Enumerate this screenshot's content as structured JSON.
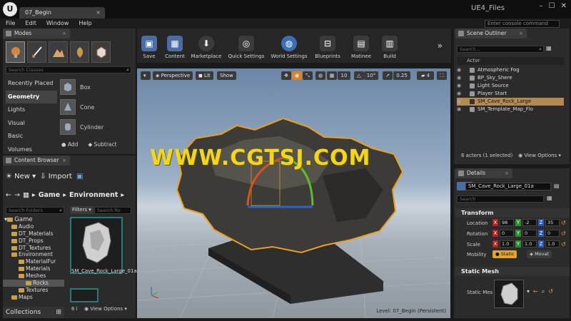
{
  "window": {
    "logo": "U",
    "tab_label": "07_Begin",
    "project_name": "UE4_Files",
    "tab_close": "×",
    "minimize": "–",
    "maximize": "☐",
    "close": "✕"
  },
  "menu": {
    "items": [
      "File",
      "Edit",
      "Window",
      "Help"
    ],
    "console_placeholder": "Enter console command"
  },
  "modes": {
    "tab_label": "Modes",
    "search_placeholder": "Search Classes",
    "categories": [
      "Recently Placed",
      "Geometry",
      "Lights",
      "Visual",
      "Basic",
      "Volumes"
    ],
    "selected_category": "Geometry",
    "shapes": [
      "Box",
      "Cone",
      "Cylinder"
    ],
    "add_label": "Add",
    "subtract_label": "Subtract"
  },
  "content_browser": {
    "tab_label": "Content Browser",
    "new_label": "New",
    "import_label": "Import",
    "breadcrumb": [
      "Game",
      "Environment"
    ],
    "search_folders_placeholder": "Search Folders",
    "filters_label": "Filters",
    "search_assets_placeholder": "Search Ro",
    "tree": [
      "Game",
      "Audio",
      "DT_Materials",
      "DT_Props",
      "DT_Textures",
      "Environment",
      "MaterialFur",
      "Materials",
      "Meshes",
      "Rocks",
      "Textures",
      "Maps"
    ],
    "selected_folder": "Rocks",
    "asset_name": "SM_Cave_Rock_Large_01a",
    "item_count": "6 i",
    "view_options": "View Options",
    "collections_label": "Collections"
  },
  "toolbar": {
    "buttons": [
      {
        "label": "Save",
        "icon": "save-icon",
        "color": "#4a6ea3"
      },
      {
        "label": "Content",
        "icon": "content-icon",
        "color": "#4a6ea3"
      },
      {
        "label": "Marketplace",
        "icon": "marketplace-icon",
        "color": "#3b3b3b"
      },
      {
        "label": "Quick Settings",
        "icon": "settings-icon",
        "color": "#3b3b3b"
      },
      {
        "label": "World Settings",
        "icon": "world-icon",
        "color": "#3c6fb1"
      },
      {
        "label": "Blueprints",
        "icon": "blueprint-icon",
        "color": "#3b3b3b"
      },
      {
        "label": "Matinee",
        "icon": "matinee-icon",
        "color": "#3b3b3b"
      },
      {
        "label": "Build",
        "icon": "build-icon",
        "color": "#3b3b3b"
      }
    ],
    "more": "»"
  },
  "viewport": {
    "perspective_label": "Perspective",
    "lit_label": "Lit",
    "show_label": "Show",
    "grid_snap": "10",
    "rotation_snap": "10°",
    "scale_snap": "0.25",
    "camera_speed": "4",
    "watermark": "WWW.CGTSJ.COM",
    "level_label": "Level:  07_Begin (Persistent)"
  },
  "scene_outliner": {
    "tab_label": "Scene Outliner",
    "search_placeholder": "Search...",
    "column_header": "Actor",
    "actors": [
      "Atmospheric Fog",
      "BP_Sky_Shere",
      "Light Source",
      "Player Start",
      "SM_Cave_Rock_Large",
      "SM_Template_Map_Flo"
    ],
    "selected_actor": "SM_Cave_Rock_Large",
    "status": "6 actors (1 selected)",
    "view_options": "View Options"
  },
  "details": {
    "tab_label": "Details",
    "object_name": "SM_Cave_Rock_Large_01a",
    "search_placeholder": "Search",
    "transform_header": "Transform",
    "location_label": "Location",
    "rotation_label": "Rotation",
    "scale_label": "Scale",
    "mobility_label": "Mobility",
    "location": [
      "98",
      "-2",
      "35"
    ],
    "rotation": [
      "0",
      "0",
      "0"
    ],
    "scale": [
      "1.0",
      "1.0",
      "1.0"
    ],
    "static_label": "Static",
    "movable_label": "Movat",
    "static_mesh_header": "Static Mesh",
    "static_mesh_label": "Static Mes"
  },
  "colors": {
    "accent_orange": "#e0831e",
    "selection": "#b38a52",
    "watermark": "#f2d51d",
    "axis_x": "#b22222",
    "axis_y": "#2e8b2e",
    "axis_z": "#2857b8"
  }
}
